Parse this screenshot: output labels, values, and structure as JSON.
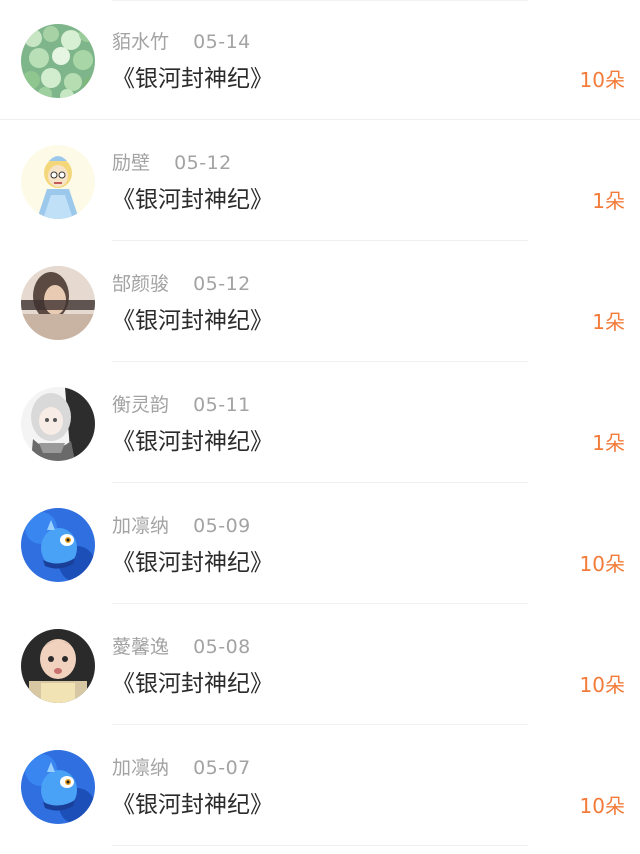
{
  "records": [
    {
      "name": "貊水竹",
      "date": "05-14",
      "book": "《银河封神纪》",
      "count": "10朵",
      "avatar": "hydrangea-photo"
    },
    {
      "name": "励壁",
      "date": "05-12",
      "book": "《银河封神纪》",
      "count": "1朵",
      "avatar": "princess-cartoon"
    },
    {
      "name": "郜颜骏",
      "date": "05-12",
      "book": "《银河封神纪》",
      "count": "1朵",
      "avatar": "woman-photo"
    },
    {
      "name": "衡灵韵",
      "date": "05-11",
      "book": "《银河封神纪》",
      "count": "1朵",
      "avatar": "anime-girl"
    },
    {
      "name": "加凛纳",
      "date": "05-09",
      "book": "《银河封神纪》",
      "count": "10朵",
      "avatar": "blue-dragon"
    },
    {
      "name": "薆馨逸",
      "date": "05-08",
      "book": "《银河封神纪》",
      "count": "10朵",
      "avatar": "baby-photo"
    },
    {
      "name": "加凛纳",
      "date": "05-07",
      "book": "《银河封神纪》",
      "count": "10朵",
      "avatar": "blue-dragon"
    }
  ],
  "colors": {
    "accent": "#f37b3a",
    "muted_text": "#a3a3a3",
    "primary_text": "#2b2b2b",
    "divider": "#f0f0f0"
  }
}
